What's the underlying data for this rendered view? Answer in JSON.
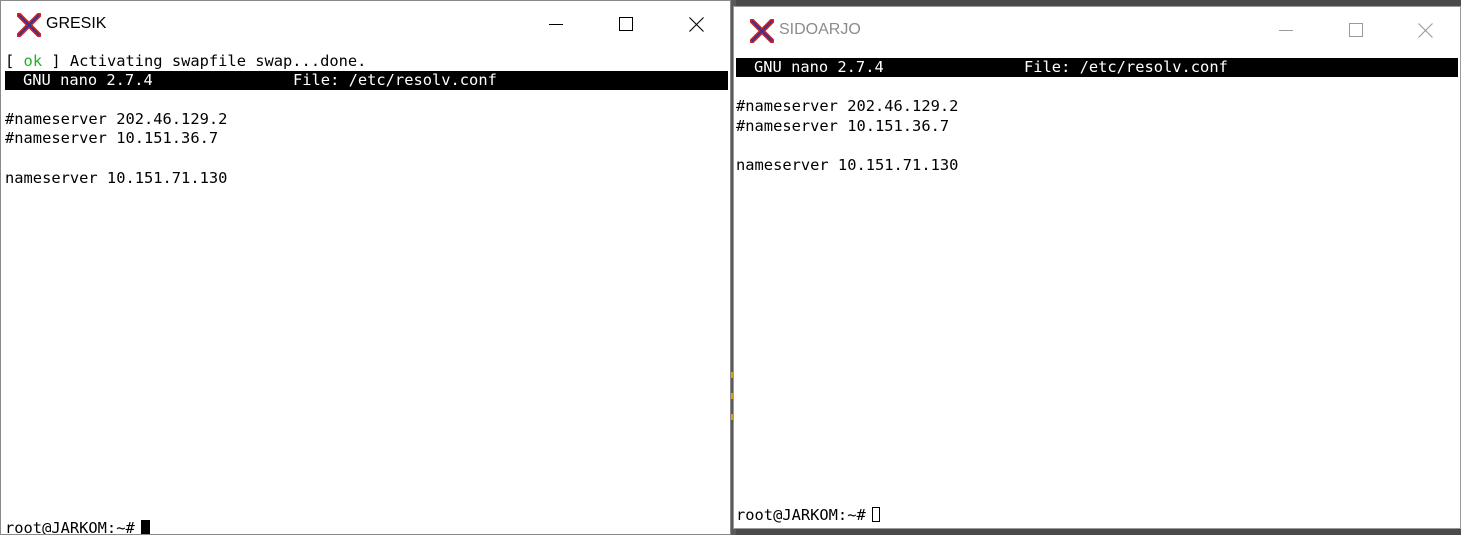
{
  "colors": {
    "desktop": "#4a4a4a",
    "ok_status": "#22b122",
    "title_inactive": "#8c8c8c",
    "icon_red": "#d22020",
    "icon_blue": "#1c3aa8"
  },
  "windows": [
    {
      "title": "GRESIK",
      "active": true,
      "icon": "x-terminal-icon",
      "boot_line": {
        "open": "[ ",
        "status": "ok",
        "close": " ]",
        "message": " Activating swapfile swap...done."
      },
      "nano": {
        "version": "GNU nano 2.7.4",
        "file": "File: /etc/resolv.conf"
      },
      "lines": [
        "#nameserver 202.46.129.2",
        "#nameserver 10.151.36.7",
        "",
        "nameserver 10.151.71.130"
      ],
      "prompt": "root@JARKOM:~#"
    },
    {
      "title": "SIDOARJO",
      "active": false,
      "icon": "x-terminal-icon",
      "nano": {
        "version": "GNU nano 2.7.4",
        "file": "File: /etc/resolv.conf"
      },
      "lines": [
        "#nameserver 202.46.129.2",
        "#nameserver 10.151.36.7",
        "",
        "nameserver 10.151.71.130"
      ],
      "prompt": "root@JARKOM:~#"
    }
  ],
  "controls": {
    "minimize": "minimize-icon",
    "maximize": "maximize-icon",
    "close": "close-icon"
  }
}
